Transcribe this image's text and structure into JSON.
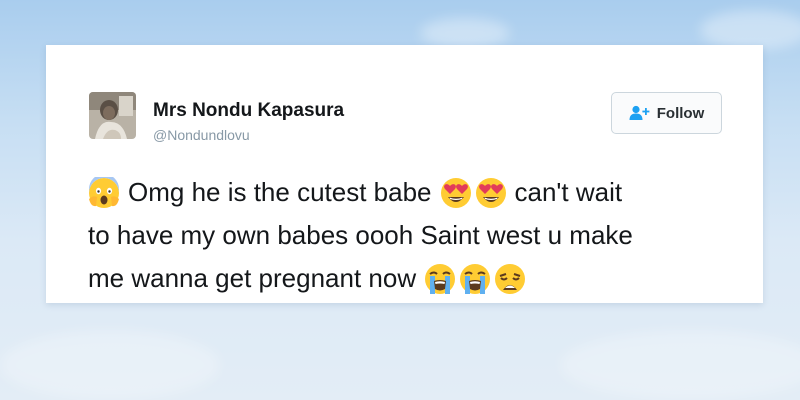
{
  "tweet": {
    "author_name": "Mrs Nondu Kapasura",
    "author_handle": "@Nondundlovu",
    "follow_label": "Follow",
    "text_line1_a": "Omg he is the cutest babe",
    "text_line1_b": "can't wait",
    "text_line2": "to have my own babes oooh Saint west u make",
    "text_line3": "me wanna get pregnant now",
    "emojis": [
      "face-screaming-in-fear-icon",
      "heart-eyes-icon",
      "heart-eyes-icon",
      "loudly-crying-face-icon",
      "loudly-crying-face-icon",
      "weary-face-icon"
    ]
  },
  "colors": {
    "accent": "#1da1f2",
    "name": "#14171a",
    "handle": "#8899a6"
  }
}
